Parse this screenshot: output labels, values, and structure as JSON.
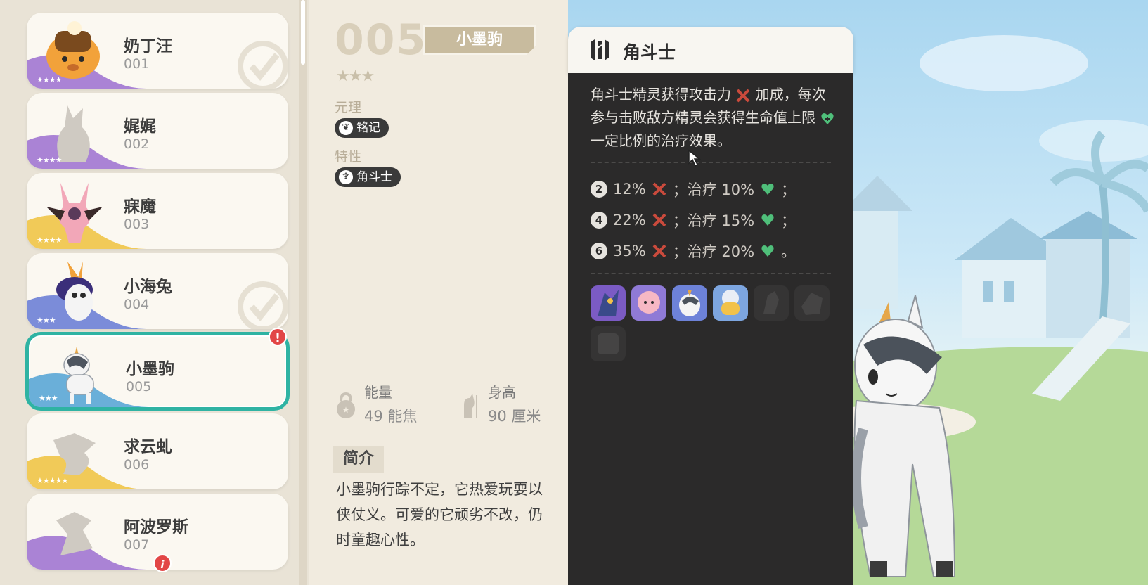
{
  "list": {
    "items": [
      {
        "name": "奶丁汪",
        "num": "001",
        "stars": "★★★★",
        "wave": "#9b6fd0",
        "checked": true
      },
      {
        "name": "娓娓",
        "num": "002",
        "stars": "★★★★",
        "wave": "#9b6fd0",
        "checked": false
      },
      {
        "name": "寐魔",
        "num": "003",
        "stars": "★★★★",
        "wave": "#f0c447",
        "checked": false
      },
      {
        "name": "小海兔",
        "num": "004",
        "stars": "★★★",
        "wave": "#6d7fd6",
        "checked": true
      },
      {
        "name": "小墨驹",
        "num": "005",
        "stars": "★★★",
        "wave": "#5aa6d6",
        "checked": false,
        "alert": "!"
      },
      {
        "name": "求云虬",
        "num": "006",
        "stars": "★★★★★",
        "wave": "#f0c447",
        "checked": false
      },
      {
        "name": "阿波罗斯",
        "num": "007",
        "stars": "",
        "wave": "#9b6fd0",
        "checked": false,
        "info": "i"
      }
    ]
  },
  "detail": {
    "number": "005",
    "name": "小墨驹",
    "stars": "★★★",
    "element_label": "元理",
    "element_value": "铭记",
    "trait_label": "特性",
    "trait_value": "角斗士",
    "energy_label": "能量",
    "energy_value": "49 能焦",
    "height_label": "身高",
    "height_value": "90 厘米",
    "intro_label": "简介",
    "intro_lines": [
      "小墨驹行踪不定，它热爱玩耍以",
      "侠仗义。可爱的它顽劣不改，仍",
      "时童趣心性。"
    ]
  },
  "tooltip": {
    "title": "角斗士",
    "desc_1": "角斗士精灵获得攻击力",
    "desc_2": "加成，每次参与击败敌方精灵会获得生命值上限",
    "desc_3": "一定比例的治疗效果。",
    "tiers": [
      {
        "n": "2",
        "atk": "12%",
        "heal": "；治疗 10%",
        "end": "；"
      },
      {
        "n": "4",
        "atk": "22%",
        "heal": "；治疗 15%",
        "end": "；"
      },
      {
        "n": "6",
        "atk": "35%",
        "heal": "；治疗 20%",
        "end": "。"
      }
    ]
  },
  "colors": {
    "accent": "#2fb3a3",
    "alert": "#e24646",
    "attack_icon": "#c94a3c",
    "heal_icon": "#4fbf7a"
  }
}
